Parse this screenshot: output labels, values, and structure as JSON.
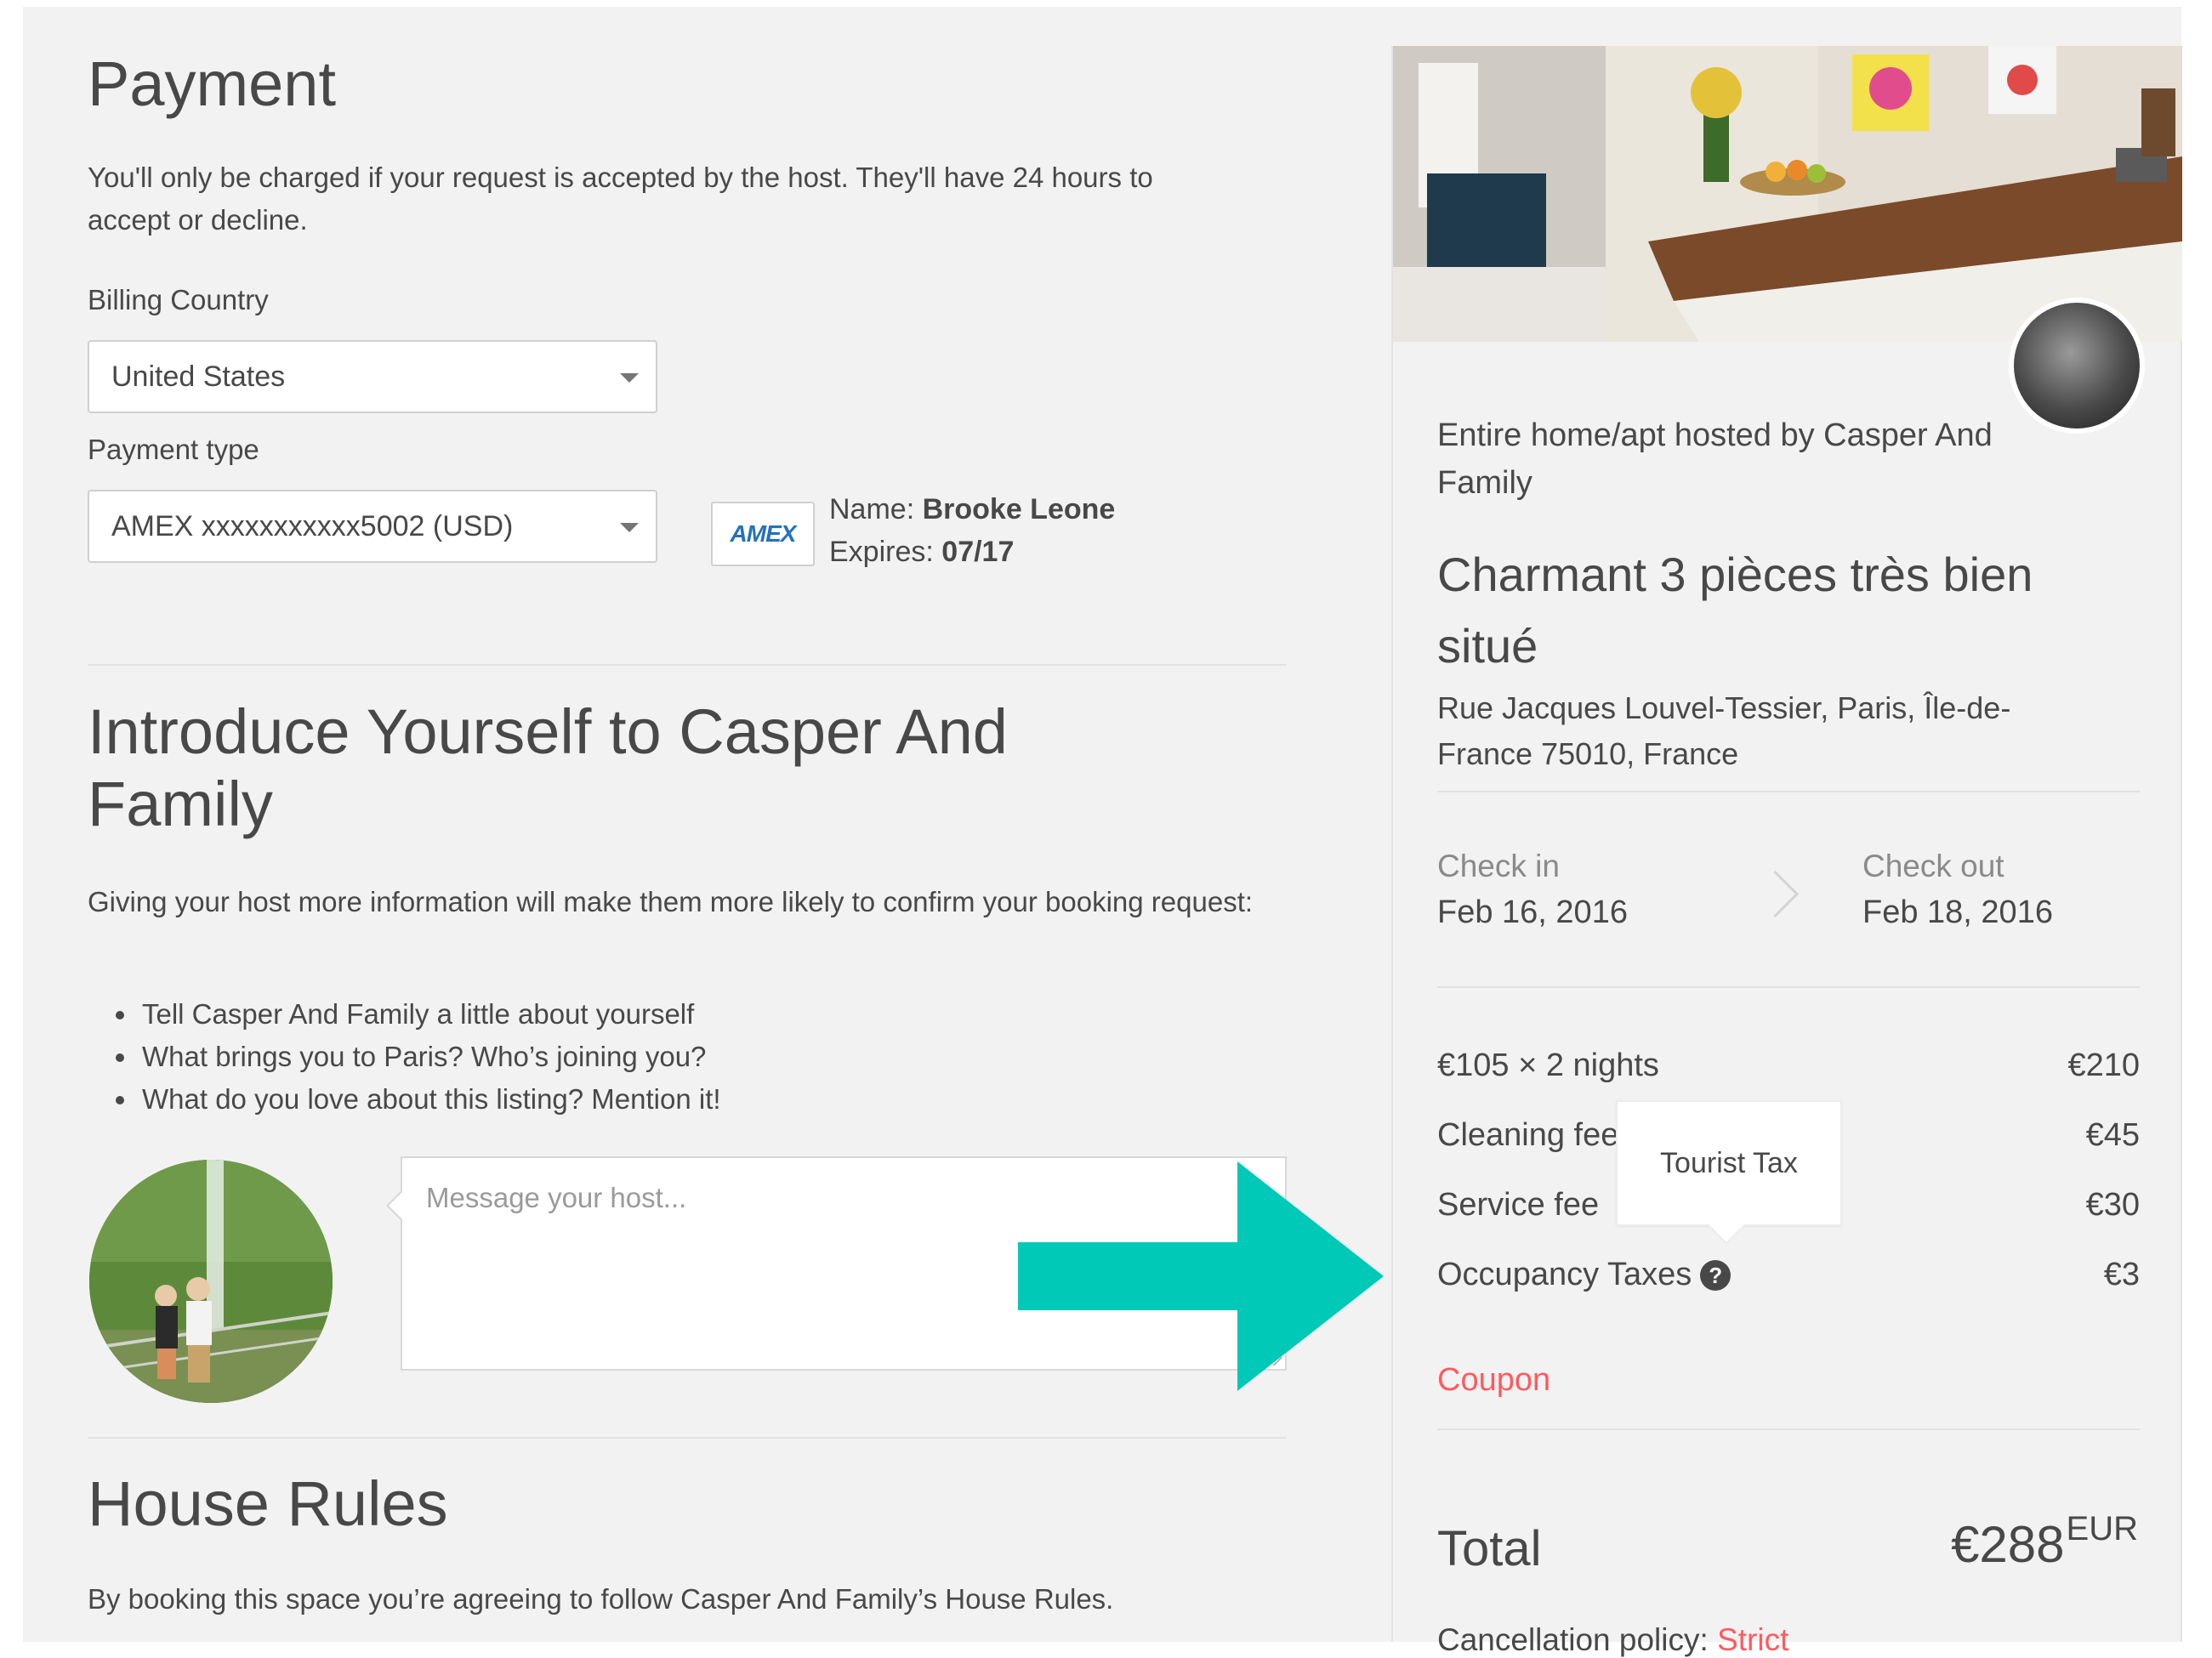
{
  "payment": {
    "title": "Payment",
    "description": "You'll only be charged if your request is accepted by the host. They'll have 24 hours to accept or decline.",
    "billing_country_label": "Billing Country",
    "billing_country_value": "United States",
    "payment_type_label": "Payment type",
    "payment_type_value": "AMEX xxxxxxxxxxx5002 (USD)",
    "card_badge": "AMEX",
    "card_name_label": "Name:",
    "card_name_value": "Brooke Leone",
    "card_expires_label": "Expires:",
    "card_expires_value": "07/17"
  },
  "introduce": {
    "title": "Introduce Yourself to Casper And Family",
    "description": "Giving your host more information will make them more likely to confirm your booking request:",
    "bullets": [
      "Tell Casper And Family a little about yourself",
      "What brings you to Paris? Who’s joining you?",
      "What do you love about this listing? Mention it!"
    ],
    "message_placeholder": "Message your host..."
  },
  "house_rules": {
    "title": "House Rules",
    "description": "By booking this space you’re agreeing to follow Casper And Family’s House Rules."
  },
  "listing": {
    "hosted_by": "Entire home/apt hosted by Casper And Family",
    "title": "Charmant 3 pièces très bien situé",
    "address": "Rue Jacques Louvel-Tessier, Paris, Île-de-France 75010, France",
    "check_in_label": "Check in",
    "check_in_value": "Feb 16, 2016",
    "check_out_label": "Check out",
    "check_out_value": "Feb 18, 2016",
    "prices": [
      {
        "label": "€105 × 2 nights",
        "value": "€210"
      },
      {
        "label": "Cleaning fee",
        "value": "€45"
      },
      {
        "label": "Service fee",
        "value": "€30"
      },
      {
        "label": "Occupancy Taxes",
        "value": "€3"
      }
    ],
    "tooltip": "Tourist Tax",
    "coupon": "Coupon",
    "total_label": "Total",
    "total_value": "€288",
    "total_currency": "EUR",
    "cancellation_label": "Cancellation policy:",
    "cancellation_value": "Strict"
  },
  "colors": {
    "accent_red": "#ff5a5f",
    "arrow_teal": "#00c9b7",
    "background": "#f2f2f2",
    "text": "#484848"
  },
  "icons": [
    "chevron-down-icon",
    "help-icon",
    "chevron-right-icon",
    "arrow-right-icon"
  ]
}
